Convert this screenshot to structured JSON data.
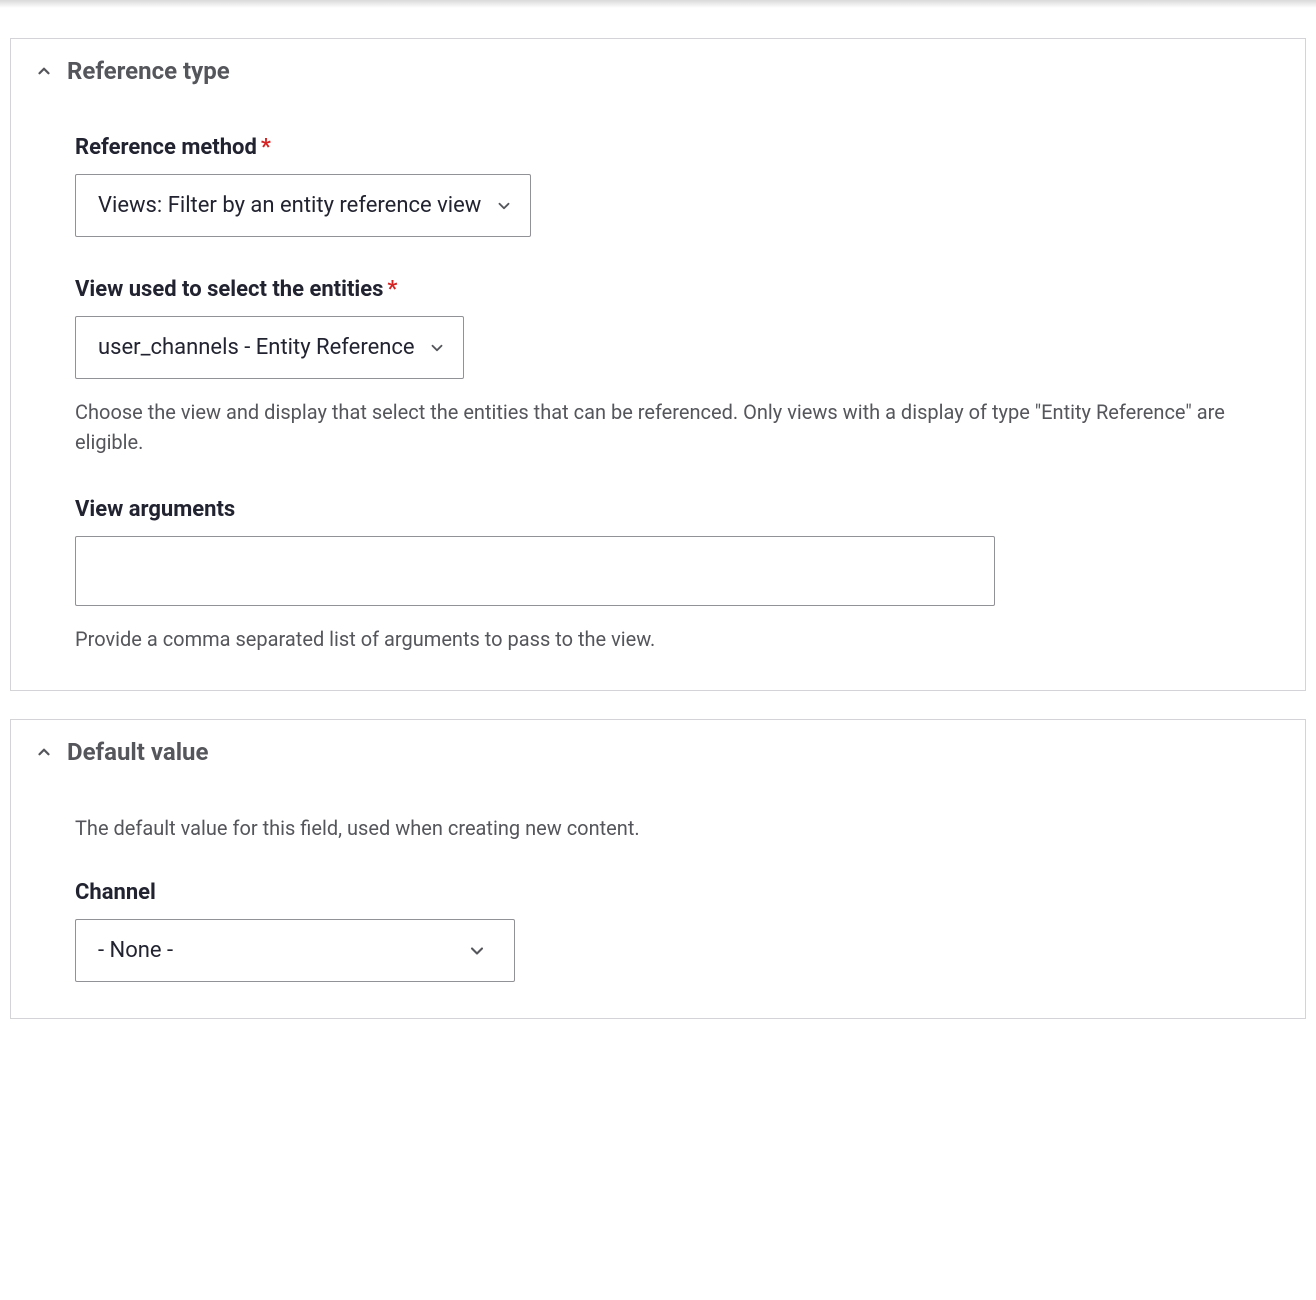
{
  "sections": {
    "reference_type": {
      "title": "Reference type",
      "fields": {
        "reference_method": {
          "label": "Reference method",
          "required": true,
          "value": "Views: Filter by an entity reference view"
        },
        "view_used": {
          "label": "View used to select the entities",
          "required": true,
          "value": "user_channels - Entity Reference",
          "description": "Choose the view and display that select the entities that can be referenced. Only views with a display of type \"Entity Reference\" are eligible."
        },
        "view_arguments": {
          "label": "View arguments",
          "value": "",
          "description": "Provide a comma separated list of arguments to pass to the view."
        }
      }
    },
    "default_value": {
      "title": "Default value",
      "intro": "The default value for this field, used when creating new content.",
      "fields": {
        "channel": {
          "label": "Channel",
          "value": "- None -"
        }
      }
    }
  },
  "required_marker": "*"
}
